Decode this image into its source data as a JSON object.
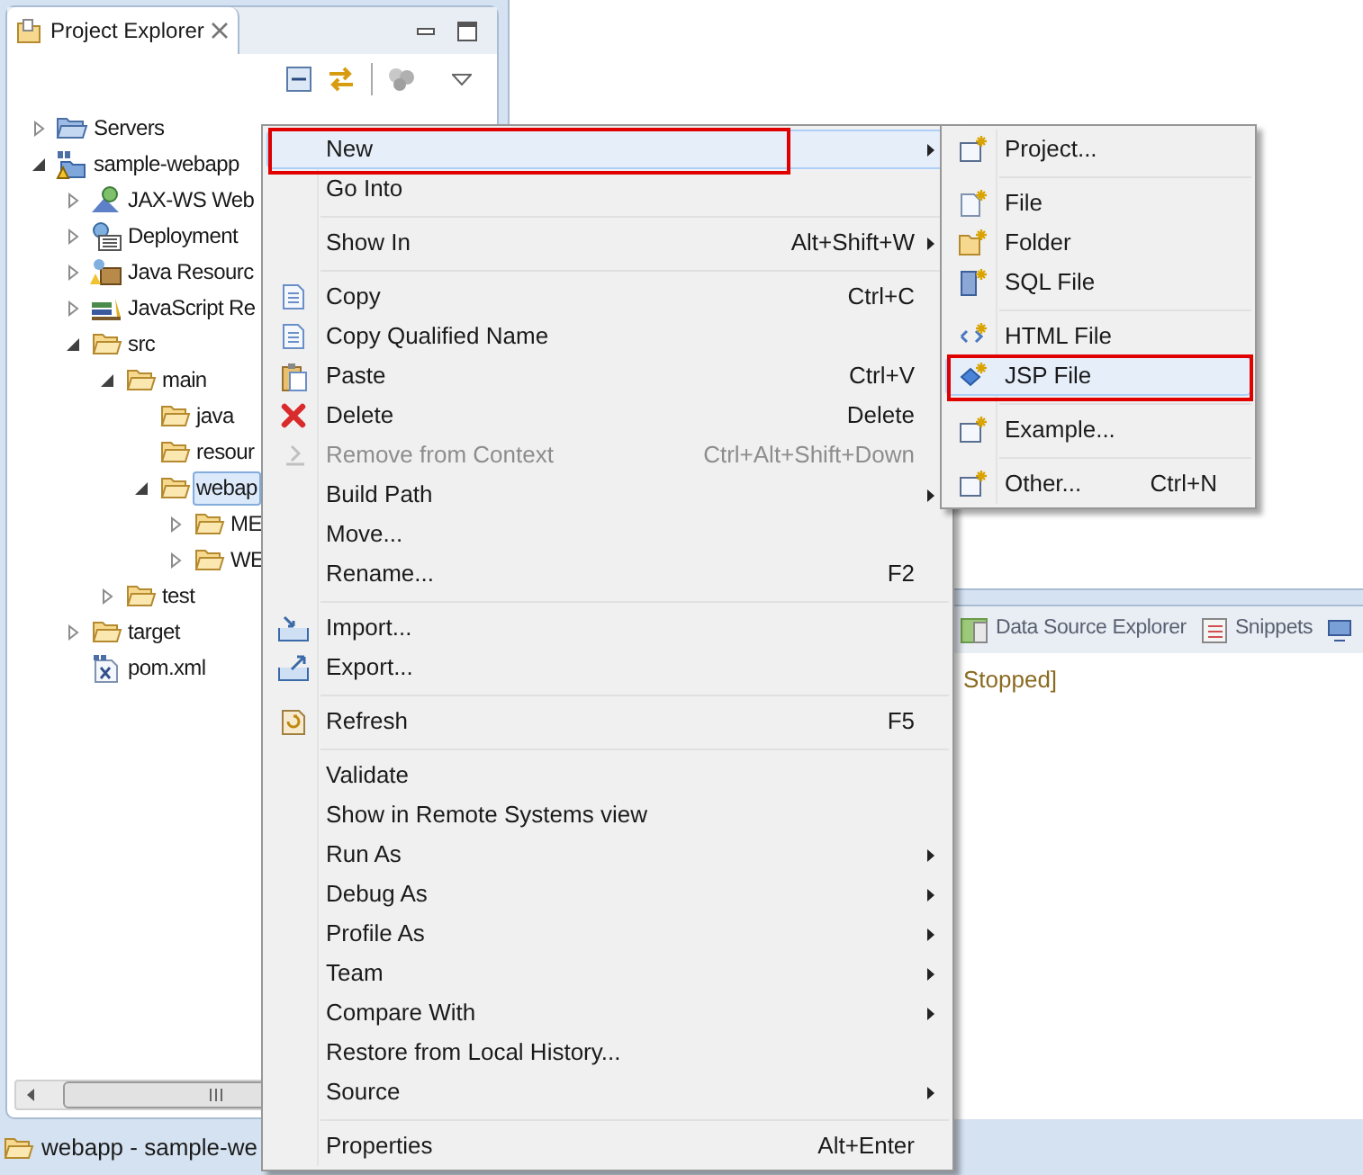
{
  "explorer": {
    "title": "Project Explorer",
    "tree": [
      {
        "label": "Servers",
        "kind": "servers",
        "expanded": false,
        "selected": false
      },
      {
        "label": "sample-webapp",
        "kind": "project",
        "expanded": true,
        "selected": false,
        "children": [
          {
            "label": "JAX-WS Web",
            "kind": "webservice",
            "expanded": false,
            "selected": false
          },
          {
            "label": "Deployment",
            "kind": "deployment",
            "expanded": false,
            "selected": false
          },
          {
            "label": "Java Resourc",
            "kind": "resources",
            "expanded": false,
            "selected": false
          },
          {
            "label": "JavaScript Re",
            "kind": "library",
            "expanded": false,
            "selected": false
          },
          {
            "label": "src",
            "kind": "folder",
            "expanded": true,
            "selected": false,
            "children": [
              {
                "label": "main",
                "kind": "folder",
                "expanded": true,
                "selected": false,
                "children": [
                  {
                    "label": "java",
                    "kind": "folder",
                    "selected": false
                  },
                  {
                    "label": "resour",
                    "kind": "folder",
                    "selected": false
                  },
                  {
                    "label": "webap",
                    "kind": "folder",
                    "expanded": true,
                    "selected": true,
                    "children": [
                      {
                        "label": "ME",
                        "kind": "folder",
                        "expanded": false,
                        "selected": false
                      },
                      {
                        "label": "WE",
                        "kind": "folder",
                        "expanded": false,
                        "selected": false
                      }
                    ]
                  }
                ]
              },
              {
                "label": "test",
                "kind": "folder",
                "expanded": false,
                "selected": false
              }
            ]
          },
          {
            "label": "target",
            "kind": "folder",
            "expanded": false,
            "selected": false
          },
          {
            "label": "pom.xml",
            "kind": "xml",
            "selected": false
          }
        ]
      }
    ]
  },
  "bottom_panel": {
    "tabs": [
      {
        "label": "Data Source Explorer"
      },
      {
        "label": "Snippets"
      }
    ],
    "console_text": "Stopped]"
  },
  "status_bar": {
    "text": "webapp - sample-we"
  },
  "context_menu": {
    "items": [
      {
        "kind": "command",
        "label": "New",
        "submenu": true,
        "selected": true,
        "disabled": false
      },
      {
        "kind": "command",
        "label": "Go Into",
        "submenu": false,
        "selected": false,
        "disabled": false
      },
      {
        "kind": "separator"
      },
      {
        "kind": "command",
        "label": "Show In",
        "shortcut": "Alt+Shift+W",
        "submenu": true,
        "selected": false,
        "disabled": false
      },
      {
        "kind": "separator"
      },
      {
        "kind": "command",
        "label": "Copy",
        "shortcut": "Ctrl+C",
        "submenu": false,
        "selected": false,
        "disabled": false
      },
      {
        "kind": "command",
        "label": "Copy Qualified Name",
        "submenu": false,
        "selected": false,
        "disabled": false
      },
      {
        "kind": "command",
        "label": "Paste",
        "shortcut": "Ctrl+V",
        "submenu": false,
        "selected": false,
        "disabled": false
      },
      {
        "kind": "command",
        "label": "Delete",
        "shortcut": "Delete",
        "submenu": false,
        "selected": false,
        "disabled": false
      },
      {
        "kind": "command",
        "label": "Remove from Context",
        "shortcut": "Ctrl+Alt+Shift+Down",
        "submenu": false,
        "selected": false,
        "disabled": true
      },
      {
        "kind": "command",
        "label": "Build Path",
        "submenu": true,
        "selected": false,
        "disabled": false
      },
      {
        "kind": "command",
        "label": "Move...",
        "submenu": false,
        "selected": false,
        "disabled": false
      },
      {
        "kind": "command",
        "label": "Rename...",
        "shortcut": "F2",
        "submenu": false,
        "selected": false,
        "disabled": false
      },
      {
        "kind": "separator"
      },
      {
        "kind": "command",
        "label": "Import...",
        "submenu": false,
        "selected": false,
        "disabled": false
      },
      {
        "kind": "command",
        "label": "Export...",
        "submenu": false,
        "selected": false,
        "disabled": false
      },
      {
        "kind": "separator"
      },
      {
        "kind": "command",
        "label": "Refresh",
        "shortcut": "F5",
        "submenu": false,
        "selected": false,
        "disabled": false
      },
      {
        "kind": "separator"
      },
      {
        "kind": "command",
        "label": "Validate",
        "submenu": false,
        "selected": false,
        "disabled": false
      },
      {
        "kind": "command",
        "label": "Show in Remote Systems view",
        "submenu": false,
        "selected": false,
        "disabled": false
      },
      {
        "kind": "command",
        "label": "Run As",
        "submenu": true,
        "selected": false,
        "disabled": false
      },
      {
        "kind": "command",
        "label": "Debug As",
        "submenu": true,
        "selected": false,
        "disabled": false
      },
      {
        "kind": "command",
        "label": "Profile As",
        "submenu": true,
        "selected": false,
        "disabled": false
      },
      {
        "kind": "command",
        "label": "Team",
        "submenu": true,
        "selected": false,
        "disabled": false
      },
      {
        "kind": "command",
        "label": "Compare With",
        "submenu": true,
        "selected": false,
        "disabled": false
      },
      {
        "kind": "command",
        "label": "Restore from Local History...",
        "submenu": false,
        "selected": false,
        "disabled": false
      },
      {
        "kind": "command",
        "label": "Source",
        "submenu": true,
        "selected": false,
        "disabled": false
      },
      {
        "kind": "separator"
      },
      {
        "kind": "command",
        "label": "Properties",
        "shortcut": "Alt+Enter",
        "submenu": false,
        "selected": false,
        "disabled": false
      }
    ]
  },
  "new_submenu": {
    "items": [
      {
        "kind": "command",
        "label": "Project...",
        "selected": false
      },
      {
        "kind": "separator"
      },
      {
        "kind": "command",
        "label": "File",
        "selected": false
      },
      {
        "kind": "command",
        "label": "Folder",
        "selected": false
      },
      {
        "kind": "command",
        "label": "SQL File",
        "selected": false
      },
      {
        "kind": "separator"
      },
      {
        "kind": "command",
        "label": "HTML File",
        "selected": false
      },
      {
        "kind": "command",
        "label": "JSP File",
        "selected": true
      },
      {
        "kind": "separator"
      },
      {
        "kind": "command",
        "label": "Example...",
        "selected": false
      },
      {
        "kind": "separator"
      },
      {
        "kind": "command",
        "label": "Other...",
        "shortcut": "Ctrl+N",
        "selected": false
      }
    ]
  }
}
